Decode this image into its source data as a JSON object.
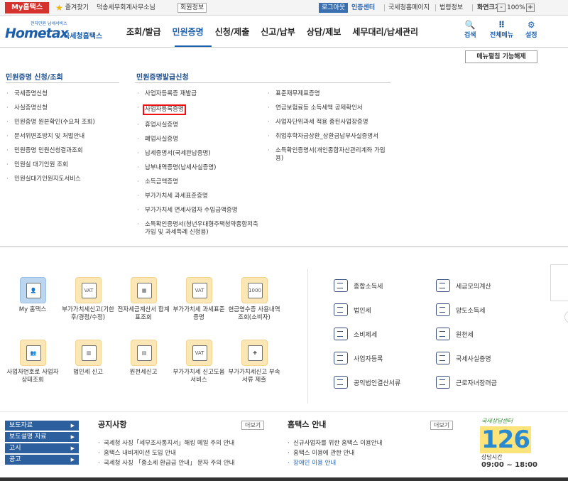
{
  "topbar": {
    "my_home": "My홈택스",
    "favorites": "즐겨찾기",
    "office_name": "덕송세무회계사무소님",
    "member_info": "회원정보",
    "logout": "로그아웃",
    "cert_center": "인증센터",
    "links": [
      "국세청홈페이지",
      "법령정보"
    ],
    "zoom_label": "화면크기",
    "zoom_value": "100%",
    "zoom_minus": "-",
    "zoom_plus": "+"
  },
  "header": {
    "logo_sub": "전자민원 납세서비스",
    "logo_home": "Home",
    "logo_tax": "tax",
    "logo_nts": "국세청홈택스",
    "nav": [
      "조회/발급",
      "민원증명",
      "신청/제출",
      "신고/납부",
      "상담/제보",
      "세무대리/납세관리"
    ],
    "icons": [
      {
        "label": "검색",
        "icon": "search-icon",
        "glyph": "🔍"
      },
      {
        "label": "전체메뉴",
        "icon": "grid-menu-icon",
        "glyph": "⠿"
      },
      {
        "label": "설정",
        "icon": "gear-icon",
        "glyph": "⚙"
      }
    ]
  },
  "megamenu": {
    "edit_button": "메뉴펼침 기능해제",
    "col1": {
      "title": "민원증명 신청/조회",
      "items": [
        "국세증명신청",
        "사실증명신청",
        "민원증명 원본확인(수요처 조회)",
        "문서위변조방지 및 처벌안내",
        "민원증명 민원신청결과조회",
        "민원실 대기인원 조회",
        "민원실대기인원지도서비스"
      ]
    },
    "col2": {
      "title": "민원증명발급신청",
      "items": [
        "사업자등록증 재발급",
        "사업자등록증명",
        "휴업사실증명",
        "폐업사실증명",
        "납세증명서(국세완납증명)",
        "납부내역증명(납세사실증명)",
        "소득금액증명",
        "부가가치세 과세표준증명",
        "부가가치세 면세사업자 수입금액증명",
        "소득확인증명서(청년우대형주택청약종합저축 가입 및 과세특례 신청용)"
      ]
    },
    "col3": {
      "items": [
        "표준재무제표증명",
        "연금보험료등 소득세액 공제확인서",
        "사업자단위과세 적용 종된사업장증명",
        "취업후학자금상환_상환금납부사실증명서",
        "소득확인증명서(개인종합자산관리계좌 가입용)"
      ]
    }
  },
  "quick": {
    "tiles": [
      {
        "label": "My 홈택스",
        "icon": "user-icon",
        "glyph": "👤"
      },
      {
        "label": "부가가치세신고(기한후/경정/수정)",
        "icon": "vat-document-icon",
        "glyph": "VAT"
      },
      {
        "label": "전자세금계산서 합계표조회",
        "icon": "invoice-calculator-icon",
        "glyph": "▦"
      },
      {
        "label": "부가가치세 과세표준증명",
        "icon": "vat-certificate-icon",
        "glyph": "VAT"
      },
      {
        "label": "현금영수증 사용내역조회(소비자)",
        "icon": "cash-receipt-icon",
        "glyph": "1000"
      },
      {
        "label": "사업자번호로 사업자상태조회",
        "icon": "users-search-icon",
        "glyph": "👥"
      },
      {
        "label": "법인세 신고",
        "icon": "building-icon",
        "glyph": "▥"
      },
      {
        "label": "원천세신고",
        "icon": "calendar-icon",
        "glyph": "▤"
      },
      {
        "label": "부가가치세 신고도움 서비스",
        "icon": "vat-help-icon",
        "glyph": "VAT"
      },
      {
        "label": "부가가치세신고 부속서류 제출",
        "icon": "document-add-icon",
        "glyph": "✚"
      }
    ],
    "taxes_left": [
      {
        "label": "종합소득세",
        "icon": "coins-icon"
      },
      {
        "label": "법인세",
        "icon": "building-icon"
      },
      {
        "label": "소비제세",
        "icon": "diamond-icon"
      },
      {
        "label": "사업자등록",
        "icon": "person-icon"
      },
      {
        "label": "공익법인결산서류",
        "icon": "clipboard-check-icon"
      }
    ],
    "taxes_right": [
      {
        "label": "세금모의계산",
        "icon": "calculator-icon"
      },
      {
        "label": "양도소득세",
        "icon": "house-hand-icon"
      },
      {
        "label": "원천세",
        "icon": "salary-icon"
      },
      {
        "label": "국세사실증명",
        "icon": "certificate-icon"
      },
      {
        "label": "근로자녀장려금",
        "icon": "heart-hand-icon"
      }
    ]
  },
  "notices": {
    "side_nav": [
      "보도자료",
      "보도설명 자료",
      "고시",
      "공고"
    ],
    "board1": {
      "title": "공지사항",
      "more": "더보기",
      "items": [
        "국세청 사칭「세무조사통지서」해킹 메일 주의 안내",
        "홈택스 내비게이션 도입 안내",
        "국세청 사칭 「종소세 환급금 안내」 문자 주의 안내"
      ]
    },
    "board2": {
      "title": "홈택스 안내",
      "more": "더보기",
      "items": [
        "신규사업자를 위한 홈택스 이용안내",
        "홈택스 이용에 관한 안내",
        "장애인 이용 안내"
      ]
    },
    "call_center": {
      "title": "국세상담센터",
      "number": "126",
      "hours_label": "상담시간",
      "hours": "09:00 ~ 18:00"
    }
  },
  "colors": {
    "brand_blue": "#1b5fab",
    "my_home_red": "#d6322d",
    "highlight_red": "#e11111"
  }
}
